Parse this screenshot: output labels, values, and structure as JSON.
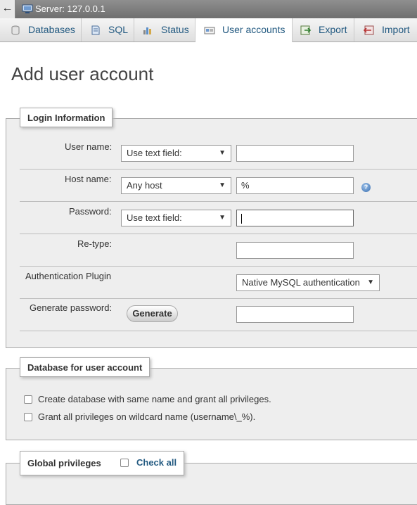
{
  "topbar": {
    "back_label": "←",
    "server": "Server: 127.0.0.1",
    "server_icon": "server-icon"
  },
  "tabs": [
    {
      "label": "Databases",
      "icon": "database-icon"
    },
    {
      "label": "SQL",
      "icon": "sql-icon"
    },
    {
      "label": "Status",
      "icon": "status-icon"
    },
    {
      "label": "User accounts",
      "icon": "user-accounts-icon",
      "active": true
    },
    {
      "label": "Export",
      "icon": "export-icon"
    },
    {
      "label": "Import",
      "icon": "import-icon"
    }
  ],
  "page": {
    "title": "Add user account"
  },
  "login": {
    "legend": "Login Information",
    "user_name": {
      "label": "User name:",
      "mode": "Use text field:",
      "value": ""
    },
    "host_name": {
      "label": "Host name:",
      "mode": "Any host",
      "value": "%"
    },
    "password": {
      "label": "Password:",
      "mode": "Use text field:",
      "value": ""
    },
    "retype": {
      "label": "Re-type:",
      "value": ""
    },
    "auth_plugin": {
      "label": "Authentication Plugin",
      "value": "Native MySQL authentication"
    },
    "generate": {
      "label": "Generate password:",
      "button": "Generate",
      "value": ""
    },
    "help_glyph": "?"
  },
  "database": {
    "legend": "Database for user account",
    "options": [
      {
        "label": "Create database with same name and grant all privileges.",
        "checked": false
      },
      {
        "label": "Grant all privileges on wildcard name (username\\_%).",
        "checked": false
      }
    ]
  },
  "global": {
    "legend": "Global privileges",
    "check_all": "Check all"
  },
  "colors": {
    "link": "#235a81",
    "panel": "#eeeeee",
    "topbar": "#7f7f7f"
  },
  "glyphs": {
    "dropdown": "▼"
  }
}
